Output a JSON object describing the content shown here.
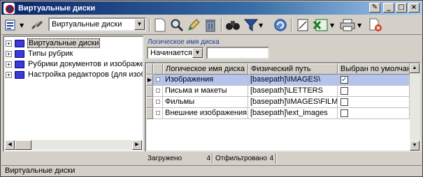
{
  "window": {
    "title": "Виртуальные диски"
  },
  "toolbar": {
    "selector_value": "Виртуальные диски"
  },
  "tree": {
    "items": [
      {
        "label": "Виртуальные диски",
        "selected": true
      },
      {
        "label": "Типы рубрик",
        "selected": false
      },
      {
        "label": "Рубрики документов и изображений",
        "selected": false
      },
      {
        "label": "Настройка редакторов (для изображ",
        "selected": false
      }
    ]
  },
  "filter": {
    "title": "Логическое имя диска",
    "condition": "Начинается",
    "value": ""
  },
  "grid": {
    "columns": [
      "Логическое имя диска",
      "Физический путь",
      "Выбран по умолчанию"
    ],
    "rows": [
      {
        "name": "Изображения",
        "path": "[basepath]\\IMAGES\\",
        "default": true
      },
      {
        "name": "Письма и макеты",
        "path": "[basepath]\\LETTERS",
        "default": false
      },
      {
        "name": "Фильмы",
        "path": "[basepath]\\IMAGES\\FILMS",
        "default": false
      },
      {
        "name": "Внешние изображения",
        "path": "[basepath]\\ext_images",
        "default": false
      }
    ]
  },
  "counters": {
    "loaded_label": "Загружено",
    "loaded_value": "4",
    "filtered_label": "Отфильтровано",
    "filtered_value": "4"
  },
  "statusbar": {
    "text": "Виртуальные диски"
  },
  "colors": {
    "title_gradient_start": "#0a246a",
    "title_gradient_end": "#a6caf0",
    "selected_row": "#b4c4ec"
  }
}
